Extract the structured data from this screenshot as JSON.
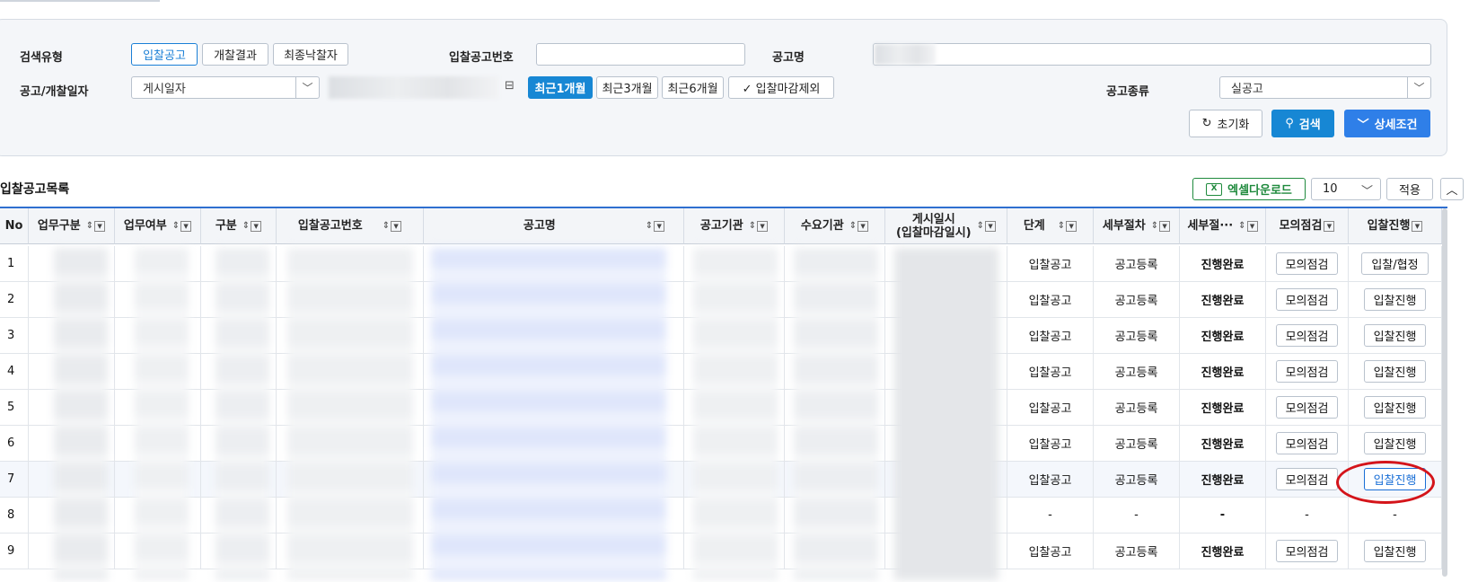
{
  "search": {
    "type_label": "검색유형",
    "type_buttons": [
      "입찰공고",
      "개찰결과",
      "최종낙찰자"
    ],
    "notice_no_label": "입찰공고번호",
    "notice_no_value": "",
    "notice_name_label": "공고명",
    "date_label": "공고/개찰일자",
    "date_type_value": "게시일자",
    "period_buttons": [
      "최근1개월",
      "최근3개월",
      "최근6개월"
    ],
    "exclude_label": "✓ 입찰마감제외",
    "kind_label": "공고종류",
    "kind_value": "실공고",
    "reset_label": "초기화",
    "search_label": "검색",
    "detail_label": "상세조건"
  },
  "list": {
    "title": "입찰공고목록",
    "excel_label": "엑셀다운로드",
    "page_size": "10",
    "apply_label": "적용"
  },
  "table": {
    "headers": {
      "no": "No",
      "biz_type": "업무구분",
      "biz_yn": "업무여부",
      "category": "구분",
      "notice_no": "입찰공고번호",
      "notice_name": "공고명",
      "agency": "공고기관",
      "demand": "수요기관",
      "posted_1": "게시일시",
      "posted_2": "(입찰마감일시)",
      "stage": "단계",
      "detail_proc": "세부절차",
      "detail_status": "세부절···",
      "mock_check": "모의점검",
      "bid_proc": "입찰진행"
    },
    "rows": [
      {
        "no": "1",
        "stage": "입찰공고",
        "detail": "공고등록",
        "status": "진행완료",
        "mock": "모의점검",
        "action": "입찰/협정"
      },
      {
        "no": "2",
        "stage": "입찰공고",
        "detail": "공고등록",
        "status": "진행완료",
        "mock": "모의점검",
        "action": "입찰진행"
      },
      {
        "no": "3",
        "stage": "입찰공고",
        "detail": "공고등록",
        "status": "진행완료",
        "mock": "모의점검",
        "action": "입찰진행"
      },
      {
        "no": "4",
        "stage": "입찰공고",
        "detail": "공고등록",
        "status": "진행완료",
        "mock": "모의점검",
        "action": "입찰진행"
      },
      {
        "no": "5",
        "stage": "입찰공고",
        "detail": "공고등록",
        "status": "진행완료",
        "mock": "모의점검",
        "action": "입찰진행"
      },
      {
        "no": "6",
        "stage": "입찰공고",
        "detail": "공고등록",
        "status": "진행완료",
        "mock": "모의점검",
        "action": "입찰진행"
      },
      {
        "no": "7",
        "stage": "입찰공고",
        "detail": "공고등록",
        "status": "진행완료",
        "mock": "모의점검",
        "action": "입찰진행"
      },
      {
        "no": "8",
        "stage": "-",
        "detail": "-",
        "status": "-",
        "mock": "-",
        "action": "-"
      },
      {
        "no": "9",
        "stage": "입찰공고",
        "detail": "공고등록",
        "status": "진행완료",
        "mock": "모의점검",
        "action": "입찰진행"
      }
    ]
  }
}
